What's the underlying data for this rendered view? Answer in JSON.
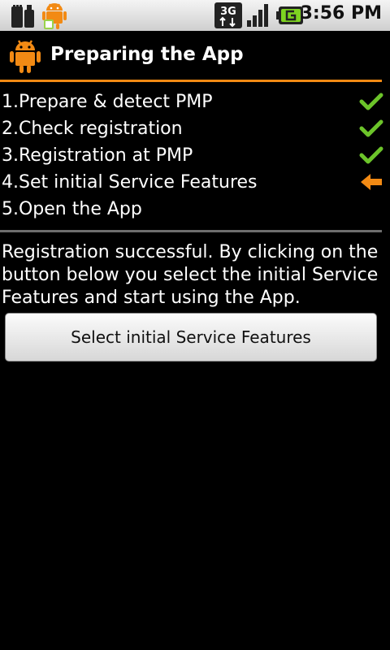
{
  "status_bar": {
    "time": "3:56 PM",
    "network_type": "3G",
    "icons": [
      "sd-card-icon",
      "android-notification-icon",
      "3g-data-icon",
      "signal-strength-icon",
      "battery-charging-icon"
    ]
  },
  "title_bar": {
    "title": "Preparing the App",
    "icon": "android-icon",
    "accent_color": "#f28a14"
  },
  "steps": [
    {
      "label": "1.Prepare & detect PMP",
      "status": "done",
      "status_icon": "checkmark-icon"
    },
    {
      "label": "2.Check registration",
      "status": "done",
      "status_icon": "checkmark-icon"
    },
    {
      "label": "3.Registration at PMP",
      "status": "done",
      "status_icon": "checkmark-icon"
    },
    {
      "label": "4.Set initial Service Features",
      "status": "current",
      "status_icon": "arrow-left-icon"
    },
    {
      "label": "5.Open the App",
      "status": "pending",
      "status_icon": ""
    }
  ],
  "message": "Registration successful. By clicking on the button below you select the initial Service Features and start using the App.",
  "primary_button": {
    "label": "Select initial Service Features"
  },
  "colors": {
    "check": "#6cc42a",
    "current_arrow": "#f28a14",
    "divider": "#6e6e6e"
  }
}
